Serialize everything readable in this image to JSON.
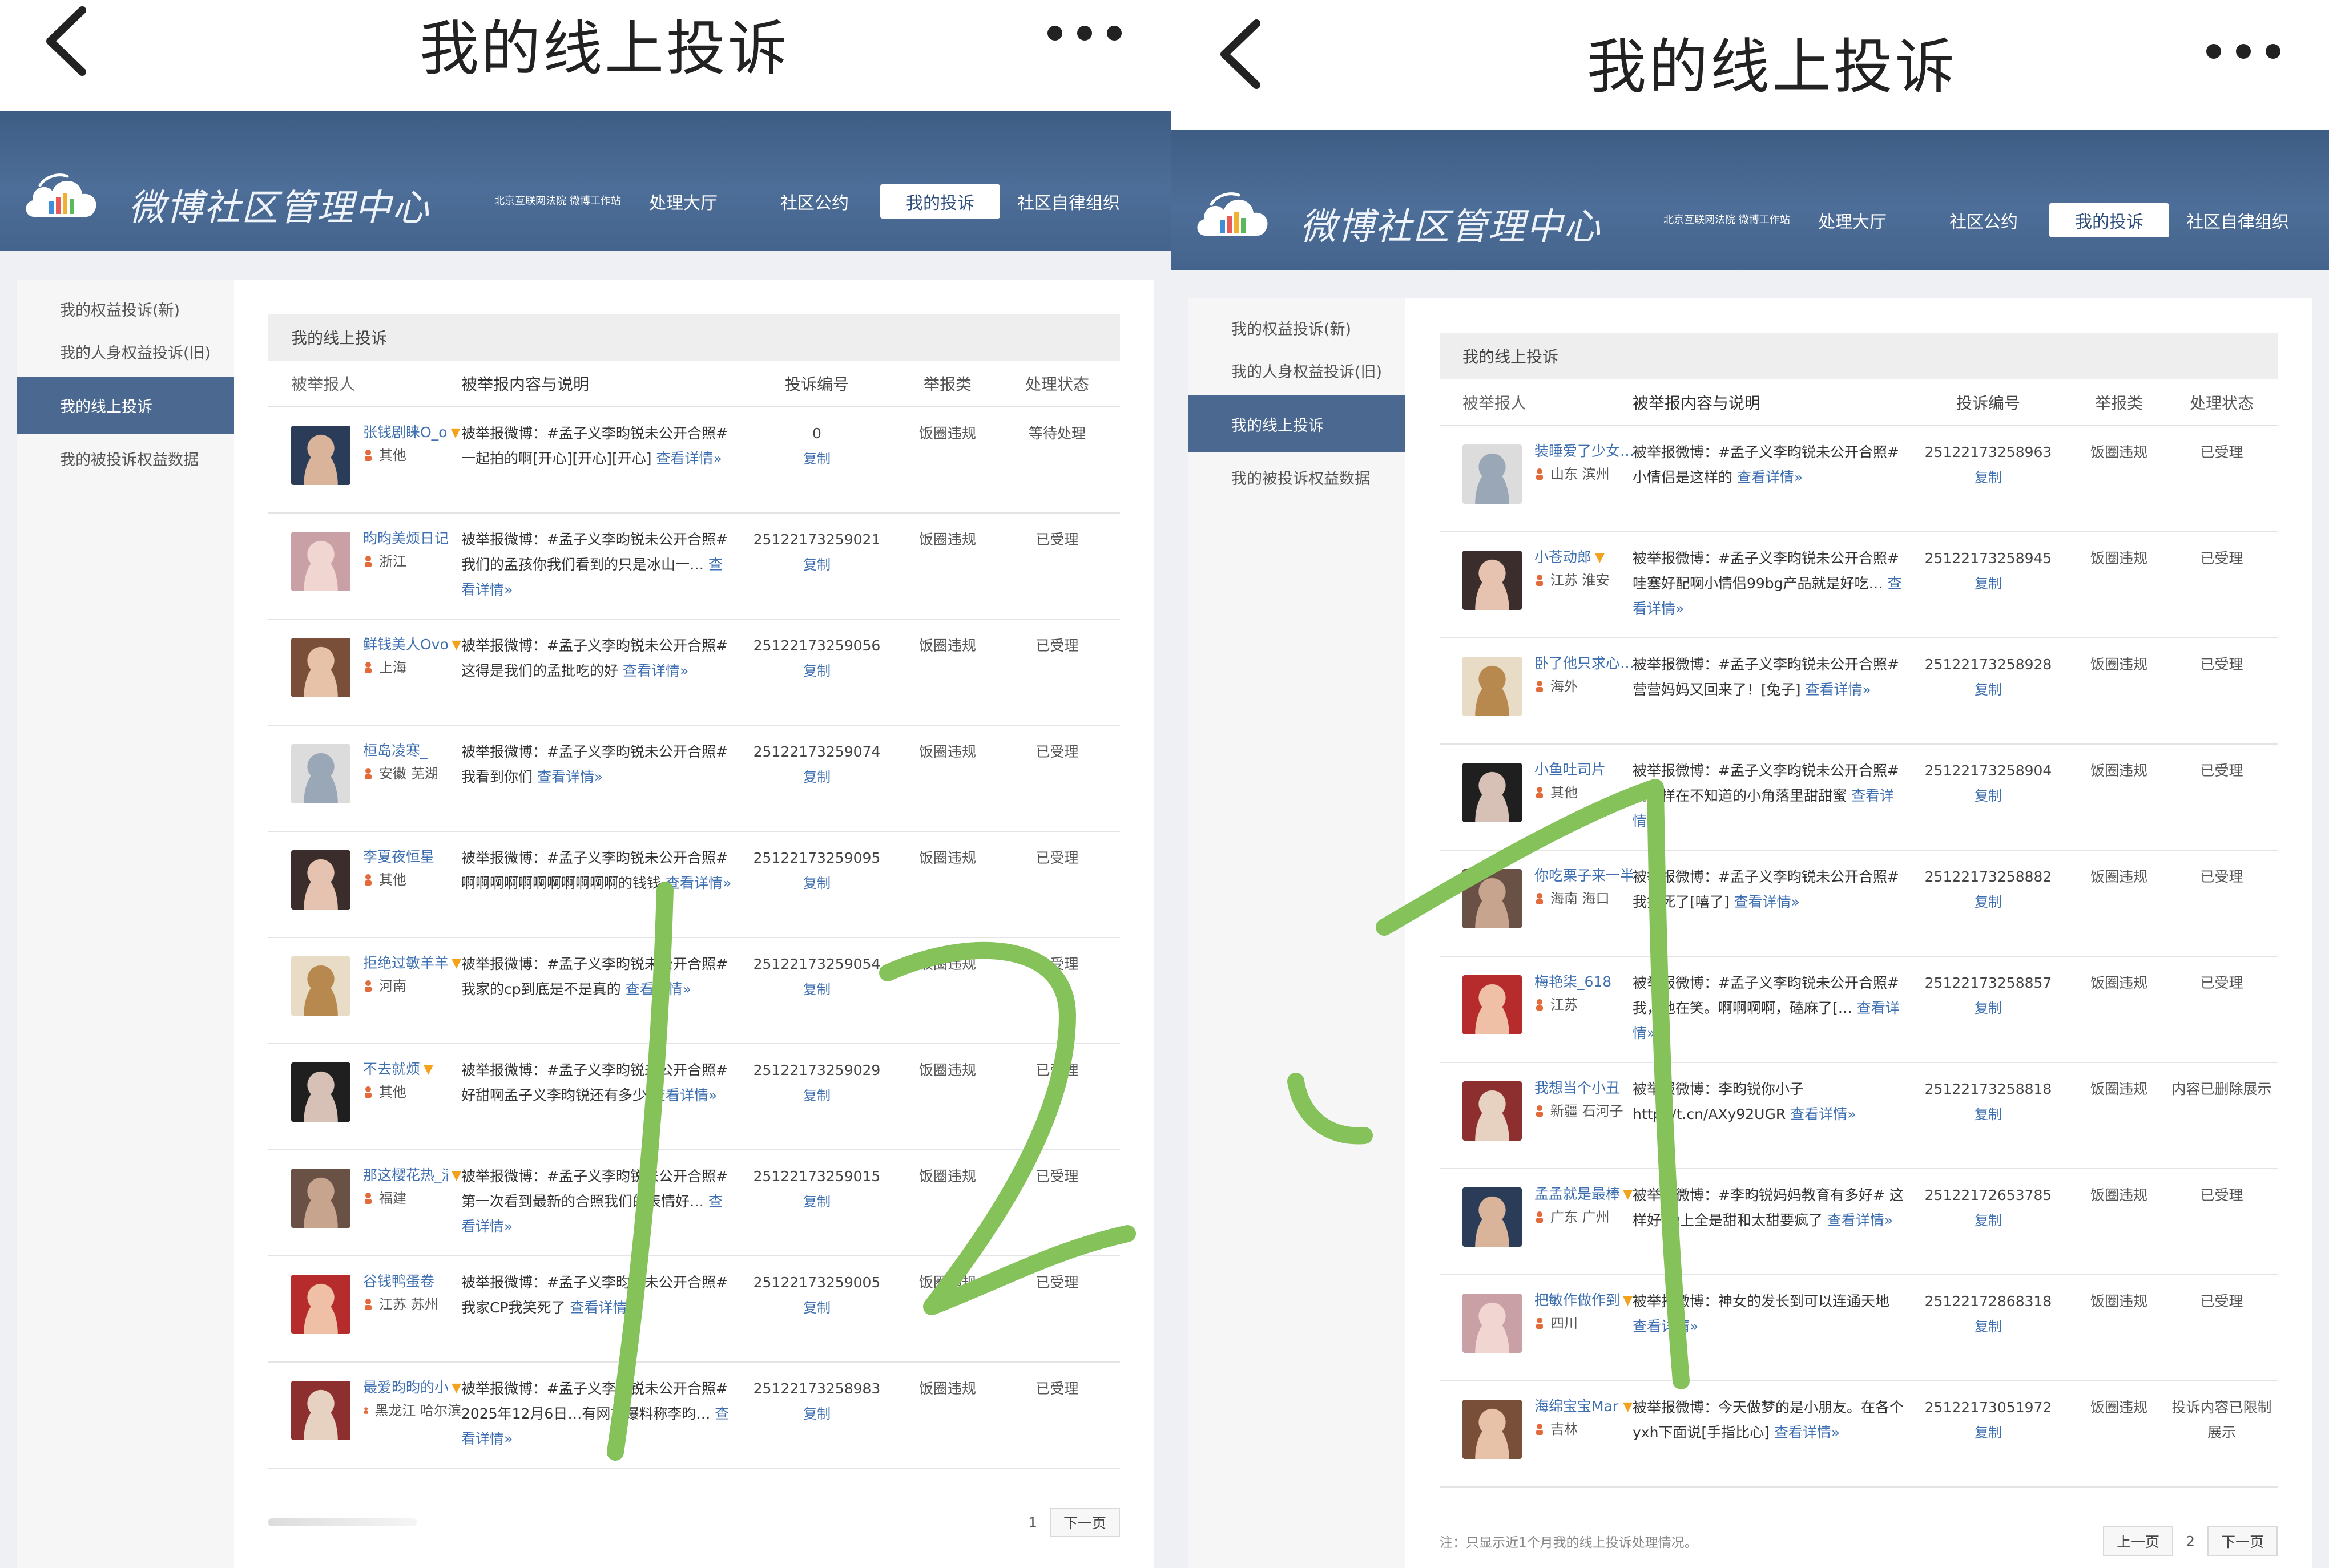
{
  "colors": {
    "banner": "#4a6890",
    "link": "#3e6fb0",
    "annotation_stroke": "#86c25a",
    "v_badge": "#f2a21c"
  },
  "icons": {
    "back": "chevron-left-icon",
    "more": "more-dots-icon",
    "logo": "cloud-logo-icon",
    "location": "person-pin-icon"
  },
  "left": {
    "topbar": {
      "title": "我的线上投诉"
    },
    "header": {
      "logo_text": "微博社区管理中心",
      "nav": [
        {
          "label": "北京互联网法院 微博工作站",
          "active": false
        },
        {
          "label": "处理大厅",
          "active": false
        },
        {
          "label": "社区公约",
          "active": false
        },
        {
          "label": "我的投诉",
          "active": true
        },
        {
          "label": "社区自律组织",
          "active": false
        }
      ]
    },
    "sidebar": [
      {
        "label": "我的权益投诉(新)",
        "active": false
      },
      {
        "label": "我的人身权益投诉(旧)",
        "active": false
      },
      {
        "label": "我的线上投诉",
        "active": true
      },
      {
        "label": "我的被投诉权益数据",
        "active": false
      }
    ],
    "section_title": "我的线上投诉",
    "columns": [
      "被举报人",
      "被举报内容与说明",
      "投诉编号",
      "举报类",
      "处理状态"
    ],
    "rows": [
      {
        "name": "张钱剧睐O_o",
        "v": true,
        "loc": "其他",
        "text": "被举报微博：#孟子义李昀锐未公开合照# 一起拍的啊[开心][开心][开心]",
        "more": "查看详情»",
        "id": "0",
        "copy": "复制",
        "type": "饭圈违规",
        "status": "等待处理"
      },
      {
        "name": "昀昀美烦日记",
        "v": false,
        "loc": "浙江",
        "text": "被举报微博：#孟子义李昀锐未公开合照# 我们的孟孩你我们看到的只是冰山一…",
        "more": "查看详情»",
        "id": "2512217325902​1",
        "copy": "复制",
        "type": "饭圈违规",
        "status": "已受理"
      },
      {
        "name": "鲜钱美人Ovo",
        "v": true,
        "loc": "上海",
        "text": "被举报微博：#孟子义李昀锐未公开合照# 这得是我们的孟批吃的好",
        "more": "查看详情»",
        "id": "25122173259056",
        "copy": "复制",
        "type": "饭圈违规",
        "status": "已受理"
      },
      {
        "name": "桓岛凌寒_",
        "v": false,
        "loc": "安徽 芜湖",
        "text": "被举报微博：#孟子义李昀锐未公开合照# 我看到你们",
        "more": "查看详情»",
        "id": "25122173259074",
        "copy": "复制",
        "type": "饭圈违规",
        "status": "已受理"
      },
      {
        "name": "李夏夜恒星",
        "v": false,
        "loc": "其他",
        "text": "被举报微博：#孟子义李昀锐未公开合照# 啊啊啊啊啊啊啊啊啊啊啊的钱钱",
        "more": "查看详情»",
        "id": "25122173259095",
        "copy": "复制",
        "type": "饭圈违规",
        "status": "已受理"
      },
      {
        "name": "拒绝过敏羊羊",
        "v": true,
        "loc": "河南",
        "text": "被举报微博：#孟子义李昀锐未公开合照# 我家的cp到底是不是真的",
        "more": "查看详情»",
        "id": "25122173259054",
        "copy": "复制",
        "type": "饭圈违规",
        "status": "已受理"
      },
      {
        "name": "不去就烦",
        "v": true,
        "loc": "其他",
        "text": "被举报微博：#孟子义李昀锐未公开合照# 好甜啊孟子义李昀锐还有多少",
        "more": "查看详情»",
        "id": "25122173259029",
        "copy": "复制",
        "type": "饭圈违规",
        "status": "已受理"
      },
      {
        "name": "那这樱花热_清清",
        "v": true,
        "loc": "福建",
        "text": "被举报微博：#孟子义李昀锐未公开合照# 第一次看到最新的合照我们的表情好…",
        "more": "查看详情»",
        "id": "25122173259015",
        "copy": "复制",
        "type": "饭圈违规",
        "status": "已受理"
      },
      {
        "name": "谷钱鸭蛋卷",
        "v": false,
        "loc": "江苏 苏州",
        "text": "被举报微博：#孟子义李昀锐未公开合照# 我家CP我笑死了",
        "more": "查看详情»",
        "id": "25122173259005",
        "copy": "复制",
        "type": "饭圈违规",
        "status": "已受理"
      },
      {
        "name": "最爱昀昀的小…",
        "v": true,
        "loc": "黑龙江 哈尔滨",
        "text": "被举报微博：#孟子义李昀锐未公开合照# 2025年12月6日…有网友爆料称李昀…",
        "more": "查看详情»",
        "id": "25122173258983",
        "copy": "复制",
        "type": "饭圈违规",
        "status": "已受理"
      }
    ],
    "footer": {
      "page": "1",
      "next": "下一页"
    }
  },
  "right": {
    "topbar": {
      "title": "我的线上投诉"
    },
    "header": {
      "logo_text": "微博社区管理中心",
      "nav": [
        {
          "label": "北京互联网法院 微博工作站",
          "active": false
        },
        {
          "label": "处理大厅",
          "active": false
        },
        {
          "label": "社区公约",
          "active": false
        },
        {
          "label": "我的投诉",
          "active": true
        },
        {
          "label": "社区自律组织",
          "active": false
        }
      ]
    },
    "sidebar": [
      {
        "label": "我的权益投诉(新)",
        "active": false
      },
      {
        "label": "我的人身权益投诉(旧)",
        "active": false
      },
      {
        "label": "我的线上投诉",
        "active": true
      },
      {
        "label": "我的被投诉权益数据",
        "active": false
      }
    ],
    "section_title": "我的线上投诉",
    "columns": [
      "被举报人",
      "被举报内容与说明",
      "投诉编号",
      "举报类",
      "处理状态"
    ],
    "rows": [
      {
        "name": "装睡爱了少女…",
        "v": false,
        "loc": "山东 滨州",
        "text": "被举报微博：#孟子义李昀锐未公开合照# 小情侣是这样的",
        "more": "查看详情»",
        "id": "25122173258963",
        "copy": "复制",
        "type": "饭圈违规",
        "status": "已受理"
      },
      {
        "name": "小苍动郎",
        "v": true,
        "loc": "江苏 淮安",
        "text": "被举报微博：#孟子义李昀锐未公开合照# 哇塞好配啊小情侣99bg产品就是好吃…",
        "more": "查看详情»",
        "id": "25122173258945",
        "copy": "复制",
        "type": "饭圈违规",
        "status": "已受理"
      },
      {
        "name": "卧了他只求心…",
        "v": false,
        "loc": "海外",
        "text": "被举报微博：#孟子义李昀锐未公开合照# 营营妈妈又回来了！[兔子]",
        "more": "查看详情»",
        "id": "25122173258928",
        "copy": "复制",
        "type": "饭圈违规",
        "status": "已受理"
      },
      {
        "name": "小鱼吐司片",
        "v": false,
        "loc": "其他",
        "text": "被举报微博：#孟子义李昀锐未公开合照# 就这样在不知道的小角落里甜甜蜜",
        "more": "查看详情»",
        "id": "25122173258904",
        "copy": "复制",
        "type": "饭圈违规",
        "status": "已受理"
      },
      {
        "name": "你吃栗子来一半",
        "v": false,
        "loc": "海南 海口",
        "text": "被举报微博：#孟子义李昀锐未公开合照# 我笑死了[嘻了]",
        "more": "查看详情»",
        "id": "25122173258882",
        "copy": "复制",
        "type": "饭圈违规",
        "status": "已受理"
      },
      {
        "name": "梅艳柒_618",
        "v": false,
        "loc": "江苏",
        "text": "被举报微博：#孟子义李昀锐未公开合照# 我，他在笑。啊啊啊啊，磕麻了[…",
        "more": "查看详情»",
        "id": "25122173258857",
        "copy": "复制",
        "type": "饭圈违规",
        "status": "已受理"
      },
      {
        "name": "我想当个小丑",
        "v": false,
        "loc": "新疆 石河子",
        "text": "被举报微博：李昀锐你小子 http://t.cn/AXy92UGR",
        "more": "查看详情»",
        "id": "25122173258818",
        "copy": "复制",
        "type": "饭圈违规",
        "status": "内容已删除展示"
      },
      {
        "name": "孟孟就是最棒的",
        "v": true,
        "loc": "广东 广州",
        "text": "被举报微博：#李昀锐妈妈教育有多好# 这样好 晚上全是甜和太甜要疯了",
        "more": "查看详情»",
        "id": "25122172653785",
        "copy": "复制",
        "type": "饭圈违规",
        "status": "已受理"
      },
      {
        "name": "把敏作做作到底",
        "v": true,
        "loc": "四川",
        "text": "被举报微博：神女的发长到可以连通天地",
        "more": "查看详情»",
        "id": "25122172868318",
        "copy": "复制",
        "type": "饭圈违规",
        "status": "已受理"
      },
      {
        "name": "海绵宝宝Marg…",
        "v": true,
        "loc": "吉林",
        "text": "被举报微博：今天做梦的是小朋友。在各个yxh下面说[手指比心]",
        "more": "查看详情»",
        "id": "25122173051972",
        "copy": "复制",
        "type": "饭圈违规",
        "status": "投诉内容已限制展示"
      }
    ],
    "footer": {
      "note": "注：只显示近1个月我的线上投诉处理情况。",
      "prev": "上一页",
      "page": "2",
      "next": "下一页"
    }
  }
}
